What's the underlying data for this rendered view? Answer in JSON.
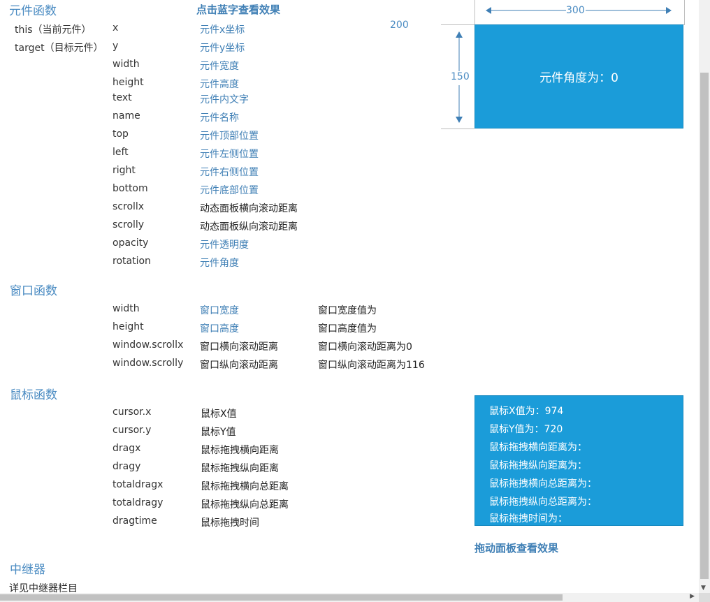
{
  "element_section": {
    "title": "元件函数",
    "hint": "点击蓝字查看效果",
    "objects": [
      "this（当前元件）",
      "target（目标元件）"
    ],
    "rows": [
      {
        "key": "x",
        "desc": "元件x坐标",
        "link": true
      },
      {
        "key": "y",
        "desc": "元件y坐标",
        "link": true
      },
      {
        "key": "width",
        "desc": "元件宽度",
        "link": true
      },
      {
        "key": "height",
        "desc": "元件高度",
        "link": true
      },
      {
        "key": "text",
        "desc": "元件内文字",
        "link": true
      },
      {
        "key": "name",
        "desc": "元件名称",
        "link": true
      },
      {
        "key": "top",
        "desc": "元件顶部位置",
        "link": true
      },
      {
        "key": "left",
        "desc": "元件左侧位置",
        "link": true
      },
      {
        "key": "right",
        "desc": "元件右侧位置",
        "link": true
      },
      {
        "key": "bottom",
        "desc": "元件底部位置",
        "link": true
      },
      {
        "key": "scrollx",
        "desc": "动态面板横向滚动距离",
        "link": false
      },
      {
        "key": "scrolly",
        "desc": "动态面板纵向滚动距离",
        "link": false
      },
      {
        "key": "opacity",
        "desc": "元件透明度",
        "link": true
      },
      {
        "key": "rotation",
        "desc": "元件角度",
        "link": true
      }
    ]
  },
  "demo": {
    "coord_label": "200",
    "width_label": "300",
    "height_label": "150",
    "box_text": "元件角度为：0"
  },
  "window_section": {
    "title": "窗口函数",
    "rows": [
      {
        "key": "width",
        "desc": "窗口宽度",
        "link": true,
        "value": "窗口宽度值为"
      },
      {
        "key": "height",
        "desc": "窗口高度",
        "link": true,
        "value": "窗口高度值为"
      },
      {
        "key": "window.scrollx",
        "desc": "窗口横向滚动距离",
        "link": false,
        "value": "窗口横向滚动距离为0"
      },
      {
        "key": "window.scrolly",
        "desc": "窗口纵向滚动距离",
        "link": false,
        "value": "窗口纵向滚动距离为116"
      }
    ]
  },
  "mouse_section": {
    "title": "鼠标函数",
    "rows": [
      {
        "key": "cursor.x",
        "desc": "鼠标X值"
      },
      {
        "key": "cursor.y",
        "desc": "鼠标Y值"
      },
      {
        "key": "dragx",
        "desc": "鼠标拖拽横向距离"
      },
      {
        "key": "dragy",
        "desc": "鼠标拖拽纵向距离"
      },
      {
        "key": "totaldragx",
        "desc": "鼠标拖拽横向总距离"
      },
      {
        "key": "totaldragy",
        "desc": "鼠标拖拽纵向总距离"
      },
      {
        "key": "dragtime",
        "desc": "鼠标拖拽时间"
      }
    ],
    "panel_lines": [
      "鼠标X值为：974",
      "鼠标Y值为：720",
      "鼠标拖拽横向距离为：",
      "鼠标拖拽纵向距离为：",
      "鼠标拖拽横向总距离为：",
      "鼠标拖拽纵向总距离为：",
      "鼠标拖拽时间为："
    ],
    "panel_hint": "拖动面板查看效果"
  },
  "repeater_section": {
    "title": "中继器",
    "note": "详见中继器栏目"
  },
  "scrollbars": {
    "vertical_down_icon": "triangle-down-icon",
    "horizontal_right_icon": "triangle-right-icon"
  }
}
